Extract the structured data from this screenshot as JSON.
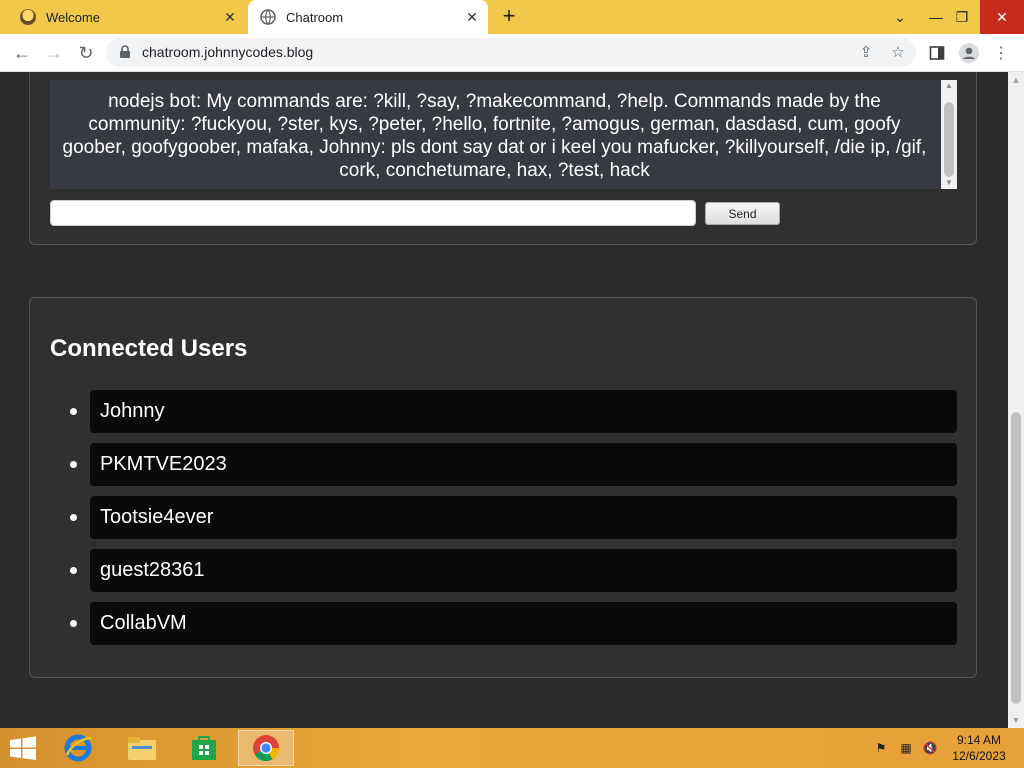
{
  "browser": {
    "tabs": [
      {
        "title": "Welcome",
        "active": false
      },
      {
        "title": "Chatroom",
        "active": true
      }
    ],
    "url": "chatroom.johnnycodes.blog"
  },
  "chat": {
    "message": "nodejs bot: My commands are: ?kill, ?say, ?makecommand, ?help. Commands made by the community: ?fuckyou, ?ster, kys, ?peter, ?hello, fortnite, ?amogus, german, dasdasd, cum, goofy goober, goofygoober, mafaka, Johnny: pls dont say dat or i keel you mafucker, ?killyourself, /die ip, /gif, cork, conchetumare, hax, ?test, hack",
    "input_value": "",
    "send_label": "Send"
  },
  "users": {
    "heading": "Connected Users",
    "list": [
      "Johnny",
      "PKMTVE2023",
      "Tootsie4ever",
      "guest28361",
      "CollabVM"
    ]
  },
  "taskbar": {
    "time": "9:14 AM",
    "date": "12/6/2023"
  },
  "colors": {
    "page_bg": "#2b2b2b",
    "card_bg": "#303030",
    "message_bg": "#373a41",
    "user_pill_bg": "#0a0a0a",
    "tabstrip": "#f1c84a"
  }
}
